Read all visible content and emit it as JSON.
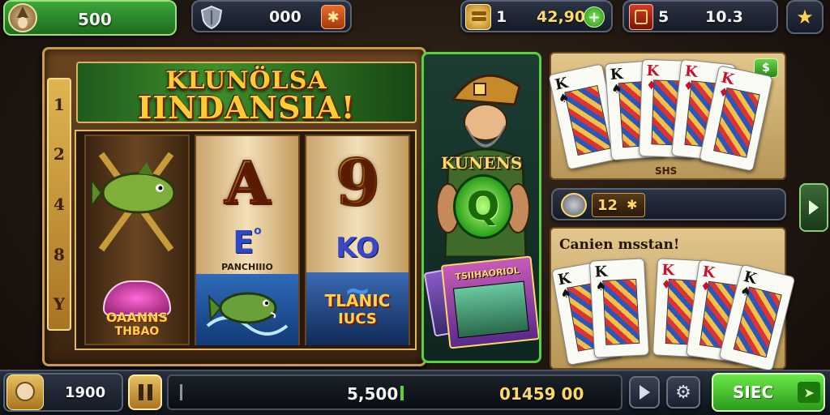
{
  "top_bar": {
    "balance": "500",
    "shield_value": "000",
    "coins_prefix": "1",
    "coins_value": "42,90",
    "tickets_prefix": "5",
    "tickets_value": "10.3"
  },
  "slot": {
    "title_line1": "KLUNÖLSA",
    "title_line2": "IINDANSIA!",
    "paylines": [
      "1",
      "2",
      "4",
      "8",
      "Y"
    ],
    "reel2": {
      "top": "A",
      "mid": "E",
      "mid_sup": "o",
      "bottom_label": "PANCHIIIO"
    },
    "reel3": {
      "top": "9",
      "mid": "KO"
    },
    "reel1_bottom": {
      "line1": "OAANNS",
      "line2": "THBAO"
    },
    "reel3_bottom": {
      "line1": "TLANIC",
      "line2": "IUCS"
    }
  },
  "character": {
    "name": "KUNENS",
    "orb": "Q",
    "card_label": "TSIIHAORIOL"
  },
  "card_panel_top": {
    "badge": "$",
    "footer": "SHS"
  },
  "card_panel_bottom": {
    "counter_value": "12",
    "title": "Canien msstan!"
  },
  "cards_top": [
    {
      "rank": "K",
      "suit": "♠",
      "color": "#111"
    },
    {
      "rank": "K",
      "suit": "♠",
      "color": "#111"
    },
    {
      "rank": "K",
      "suit": "♦",
      "color": "#c8102e"
    },
    {
      "rank": "K",
      "suit": "♦",
      "color": "#c8102e"
    },
    {
      "rank": "K",
      "suit": "♦",
      "color": "#c8102e"
    }
  ],
  "cards_bottom": [
    {
      "rank": "K",
      "suit": "♠",
      "color": "#111"
    },
    {
      "rank": "K",
      "suit": "♠",
      "color": "#111"
    },
    {
      "rank": "K",
      "suit": "♦",
      "color": "#c8102e"
    },
    {
      "rank": "K",
      "suit": "♦",
      "color": "#c8102e"
    },
    {
      "rank": "K",
      "suit": "♠",
      "color": "#111"
    }
  ],
  "bottom_bar": {
    "bet_value": "1900",
    "total": "5,500",
    "win": "01459 00",
    "spin_label": "SIEC"
  },
  "colors": {
    "accent_green": "#58d23c",
    "gold": "#ffd86a",
    "panel_border": "#c89a4a"
  }
}
